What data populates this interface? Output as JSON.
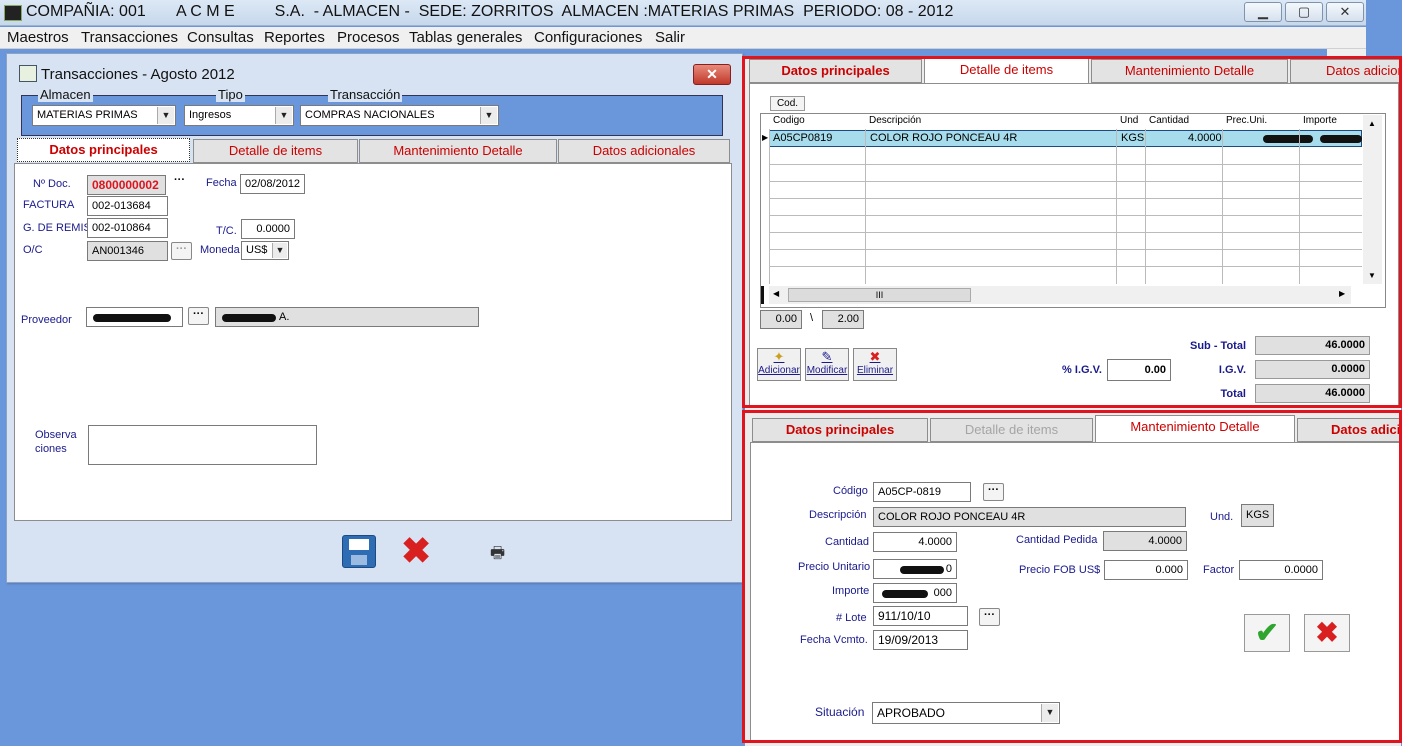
{
  "app": {
    "title": "COMPAÑIA: 001       A C M E         S.A.  - ALMACEN -  SEDE: ZORRITOS  ALMACEN :MATERIAS PRIMAS  PERIODO: 08 - 2012",
    "window_buttons": [
      "▁",
      "▢",
      "✕"
    ]
  },
  "menu": [
    "Maestros",
    "Transacciones",
    "Consultas",
    "Reportes",
    "Procesos",
    "Tablas generales",
    "Configuraciones",
    "Salir"
  ],
  "dialog": {
    "title": "Transacciones - Agosto 2012",
    "close": "✕",
    "header": {
      "almacen_label": "Almacen",
      "almacen_value": "MATERIAS PRIMAS",
      "tipo_label": "Tipo",
      "tipo_value": "Ingresos",
      "transaccion_label": "Transacción",
      "transaccion_value": "COMPRAS NACIONALES"
    },
    "tabs": [
      "Datos principales",
      "Detalle de items",
      "Mantenimiento Detalle",
      "Datos adicionales"
    ],
    "fields": {
      "ndoc_label": "Nº Doc.",
      "ndoc_value": "0800000002",
      "ndoc_more": "···",
      "fecha_label": "Fecha",
      "fecha_value": "02/08/2012",
      "factura_label": "FACTURA",
      "factura_value": "002-013684",
      "remision_label": "G. DE REMISI",
      "remision_value": "002-010864",
      "tc_label": "T/C.",
      "tc_value": "0.0000",
      "oc_label": "O/C",
      "oc_value": "AN001346",
      "oc_btn": "···",
      "moneda_label": "Moneda",
      "moneda_value": "US$",
      "proveedor_label": "Proveedor",
      "proveedor_btn": "···",
      "proveedor_name_suffix": "A.",
      "obs_label": "Observa\nciones",
      "obs_value": ""
    }
  },
  "detalle_items": {
    "tabs": [
      "Datos principales",
      "Detalle de items",
      "Mantenimiento Detalle",
      "Datos adicion"
    ],
    "cod_button": "Cod.",
    "columns": [
      "Codigo",
      "Descripción",
      "Und",
      "Cantidad",
      "Prec.Uni.",
      "Importe"
    ],
    "rows": [
      {
        "codigo": "A05CP0819",
        "descripcion": "COLOR ROJO PONCEAU 4R",
        "und": "KGS",
        "cantidad": "4.0000"
      }
    ],
    "scroll_grip": "III",
    "counter_left": "0.00",
    "counter_sep": "\\",
    "counter_right": "2.00",
    "actions": [
      "Adicionar",
      "Modificar",
      "Eliminar"
    ],
    "igv_pct_label": "% I.G.V.",
    "igv_pct_value": "0.00",
    "subtotal_label": "Sub - Total",
    "subtotal_value": "46.0000",
    "igv_label": "I.G.V.",
    "igv_value": "0.0000",
    "total_label": "Total",
    "total_value": "46.0000"
  },
  "mantenimiento": {
    "tabs": [
      "Datos principales",
      "Detalle de items",
      "Mantenimiento Detalle",
      "Datos adicio"
    ],
    "codigo_label": "Código",
    "codigo_value": "A05CP-0819",
    "codigo_btn": "···",
    "descripcion_label": "Descripción",
    "descripcion_value": "COLOR ROJO PONCEAU 4R",
    "und_label": "Und.",
    "und_value": "KGS",
    "cantidad_label": "Cantidad",
    "cantidad_value": "4.0000",
    "cant_pedida_label": "Cantidad Pedida",
    "cant_pedida_value": "4.0000",
    "precio_label": "Precio Unitario",
    "precio_suffix": "0",
    "fob_label": "Precio FOB US$",
    "fob_value": "0.000",
    "factor_label": "Factor",
    "factor_value": "0.0000",
    "importe_label": "Importe",
    "importe_suffix": "000",
    "lote_label": "# Lote",
    "lote_value": "911/10/10",
    "lote_btn": "···",
    "vcmto_label": "Fecha Vcmto.",
    "vcmto_value": "19/09/2013",
    "situacion_label": "Situación",
    "situacion_value": "APROBADO"
  }
}
